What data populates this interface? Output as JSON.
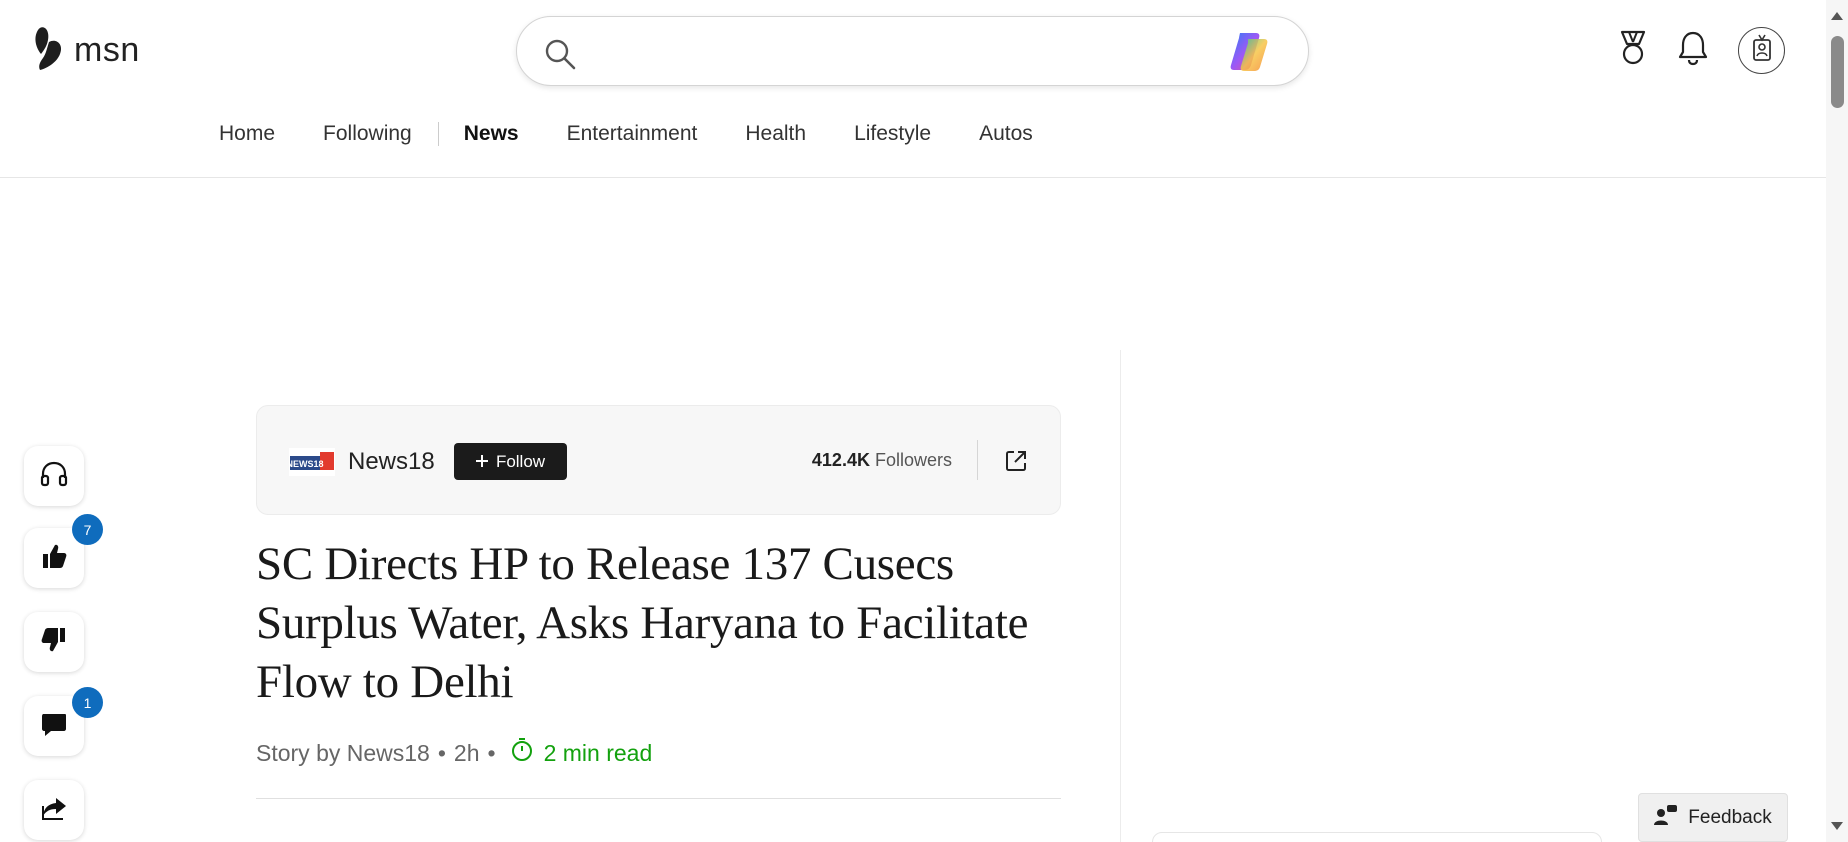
{
  "header": {
    "logo_text": "msn",
    "search": {
      "value": "",
      "placeholder": ""
    },
    "icons": [
      "rewards-medal-icon",
      "notifications-bell-icon",
      "profile-badge-icon"
    ]
  },
  "nav": {
    "items": [
      {
        "label": "Home",
        "active": false
      },
      {
        "label": "Following",
        "active": false
      },
      {
        "label": "News",
        "active": true
      },
      {
        "label": "Entertainment",
        "active": false
      },
      {
        "label": "Health",
        "active": false
      },
      {
        "label": "Lifestyle",
        "active": false
      },
      {
        "label": "Autos",
        "active": false
      }
    ]
  },
  "rail": {
    "listen": {
      "icon": "headphones-icon"
    },
    "like": {
      "icon": "thumbs-up-icon",
      "count": "7"
    },
    "dislike": {
      "icon": "thumbs-down-icon"
    },
    "comments": {
      "icon": "comment-icon",
      "count": "1"
    },
    "share": {
      "icon": "share-icon"
    }
  },
  "publisher": {
    "logo_text": "NEWS18",
    "name": "News18",
    "follow_label": "Follow",
    "followers_count": "412.4K",
    "followers_label": "Followers"
  },
  "article": {
    "headline": "SC Directs HP to Release 137 Cusecs Surplus Water, Asks Haryana to Facilitate Flow to Delhi",
    "byline_prefix": "Story by News18",
    "time_ago": "2h",
    "read_time": "2 min read"
  },
  "feedback": {
    "label": "Feedback"
  },
  "colors": {
    "accent_blue": "#0f6cbd",
    "read_time_green": "#13a10e",
    "follow_button": "#1b1b1b"
  }
}
